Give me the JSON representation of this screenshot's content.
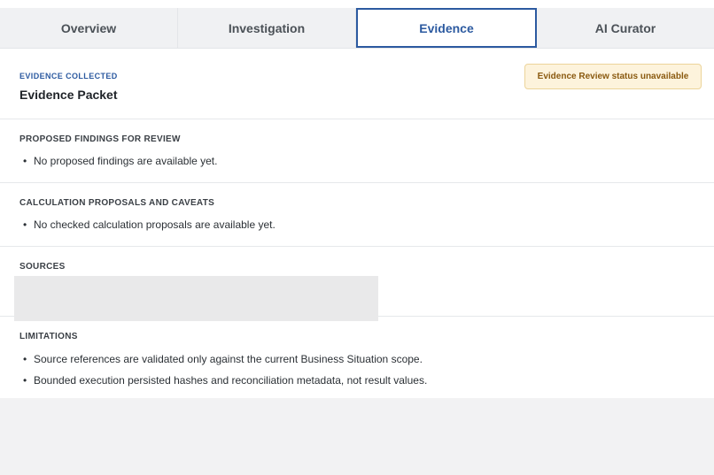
{
  "tabs": [
    {
      "label": "Overview",
      "active": false
    },
    {
      "label": "Investigation",
      "active": false
    },
    {
      "label": "Evidence",
      "active": true
    },
    {
      "label": "AI Curator",
      "active": false
    }
  ],
  "header": {
    "eyebrow": "EVIDENCE COLLECTED",
    "title": "Evidence Packet",
    "status_badge": "Evidence Review status unavailable"
  },
  "sections": {
    "findings": {
      "heading": "PROPOSED FINDINGS FOR REVIEW",
      "items": [
        "No proposed findings are available yet."
      ]
    },
    "calculations": {
      "heading": "CALCULATION PROPOSALS AND CAVEATS",
      "items": [
        "No checked calculation proposals are available yet."
      ]
    },
    "sources": {
      "heading": "SOURCES"
    },
    "limitations": {
      "heading": "LIMITATIONS",
      "items": [
        "Source references are validated only against the current Business Situation scope.",
        "Bounded execution persisted hashes and reconciliation metadata, not result values."
      ]
    }
  },
  "colors": {
    "accent": "#2c5aa0",
    "badge_bg": "#fdf3dc",
    "badge_text": "#8a5a10"
  }
}
